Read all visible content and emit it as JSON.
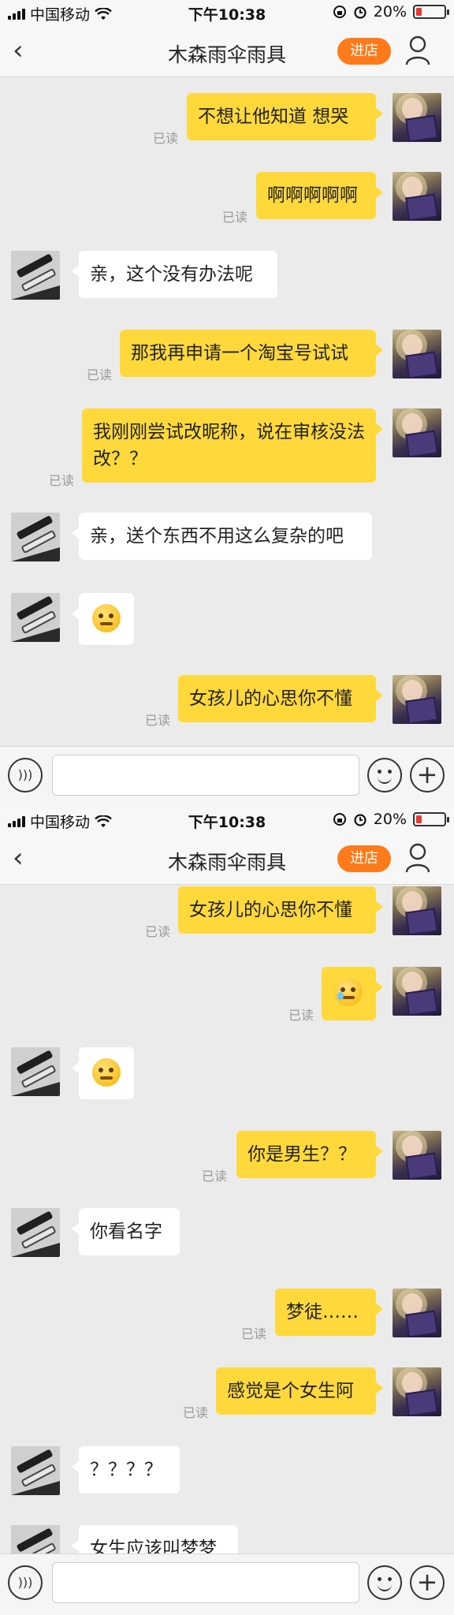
{
  "status": {
    "carrier": "中国移动",
    "time": "下午10:38",
    "battery": "20%",
    "battery_level": 0.2
  },
  "nav": {
    "back": "‹",
    "title": "木森雨伞雨具",
    "store": "进店"
  },
  "read_label": "已读",
  "screen1": {
    "messages": [
      {
        "text": "不想让他知道  想哭"
      },
      {
        "text": "啊啊啊啊啊"
      },
      {
        "text": "亲，这个没有办法呢"
      },
      {
        "text": "那我再申请一个淘宝号试试"
      },
      {
        "text": "我刚刚尝试改昵称，说在审核没法改？？"
      },
      {
        "text": "亲，送个东西不用这么复杂的吧"
      },
      {
        "text": "女孩儿的心思你不懂"
      }
    ]
  },
  "screen2": {
    "messages": [
      {
        "text": "女孩儿的心思你不懂"
      },
      {
        "text": "你是男生？？"
      },
      {
        "text": "你看名字"
      },
      {
        "text": "梦徒……"
      },
      {
        "text": "感觉是个女生阿"
      },
      {
        "text": "？？？？"
      },
      {
        "text": "女生应该叫梦梦"
      }
    ]
  },
  "icons": {
    "back": "back-arrow-icon",
    "user": "user-icon",
    "voice": "voice-icon",
    "emoji": "emoji-face-icon",
    "plus": "plus-icon",
    "wifi": "wifi-icon",
    "alarm": "alarm-icon",
    "lock": "rotation-lock-icon"
  }
}
